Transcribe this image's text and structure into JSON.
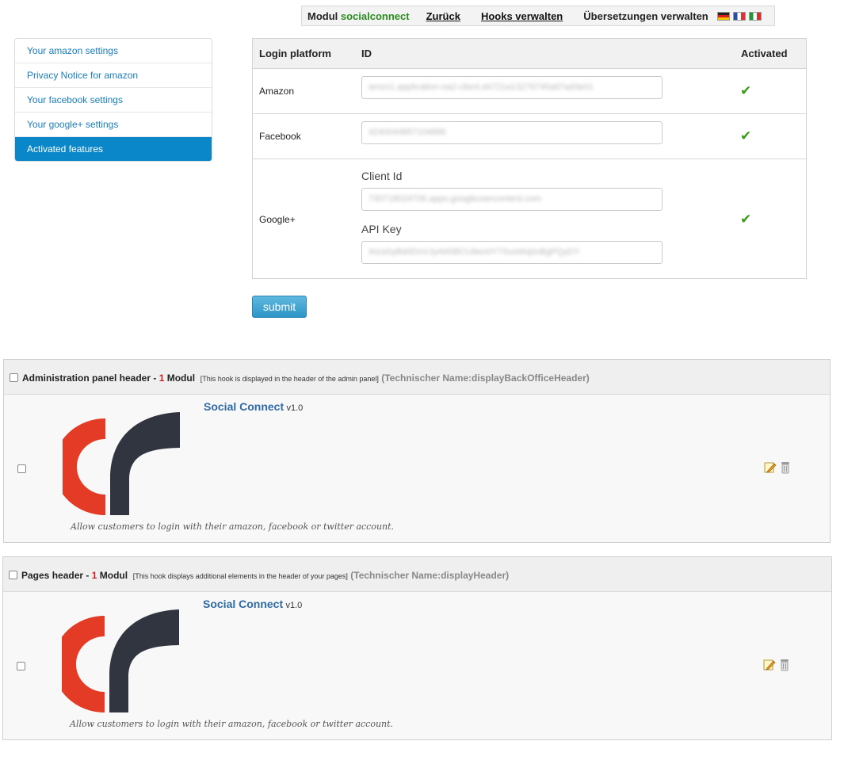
{
  "toolbar": {
    "modul_prefix": "Modul",
    "modul_name": "socialconnect",
    "back_link": "Zurück",
    "hooks_link": "Hooks verwalten",
    "translations_label": "Übersetzungen verwalten",
    "flags": [
      "de-flag-icon",
      "fr-flag-icon",
      "it-flag-icon"
    ]
  },
  "sidebar": {
    "items": [
      {
        "label": "Your amazon settings",
        "active": false
      },
      {
        "label": "Privacy Notice for amazon",
        "active": false
      },
      {
        "label": "Your facebook settings",
        "active": false
      },
      {
        "label": "Your google+ settings",
        "active": false
      },
      {
        "label": "Activated features",
        "active": true
      }
    ]
  },
  "settings": {
    "headers": {
      "platform": "Login platform",
      "id": "ID",
      "activated": "Activated"
    },
    "rows": [
      {
        "platform": "Amazon",
        "id_value": "amzn1.application-oa2-client.eb721a13276745a87ad3e01",
        "activated_icon": "checkmark-icon"
      },
      {
        "platform": "Facebook",
        "id_value": "4240044857104886",
        "activated_icon": "checkmark-icon"
      },
      {
        "platform": "Google+",
        "client_id_label": "Client Id",
        "client_id_value": "730718024706.apps.googleusercontent.com",
        "api_key_label": "API Key",
        "api_key_value": "AIzaSyBd0DnVJyA9SBCU8en0Y7SvoWq0nBgPQyDY",
        "activated_icon": "checkmark-icon"
      }
    ]
  },
  "submit_label": "submit",
  "hooks": [
    {
      "title": "Administration panel header",
      "separator": " - ",
      "count": "1",
      "count_suffix": "Modul",
      "description": "[This hook is displayed in the header of the admin panel]",
      "technical": "(Technischer Name:displayBackOfficeHeader)",
      "module": {
        "name": "Social Connect",
        "version": "v1.0",
        "description": "Allow customers to login with their amazon, facebook or twitter account.",
        "logo_icon": "social-connect-logo",
        "colors": {
          "red": "#e33b26",
          "dark": "#303540"
        }
      }
    },
    {
      "title": "Pages header",
      "separator": " - ",
      "count": "1",
      "count_suffix": "Modul",
      "description": "[This hook displays additional elements in the header of your pages]",
      "technical": "(Technischer Name:displayHeader)",
      "module": {
        "name": "Social Connect",
        "version": "v1.0",
        "description": "Allow customers to login with their amazon, facebook or twitter account.",
        "logo_icon": "social-connect-logo",
        "colors": {
          "red": "#e33b26",
          "dark": "#303540"
        }
      }
    }
  ],
  "colors": {
    "accent": "#0a87c9",
    "link": "#1a7dbd",
    "module_name": "#2a8c1e",
    "count": "#cc1f1f"
  }
}
